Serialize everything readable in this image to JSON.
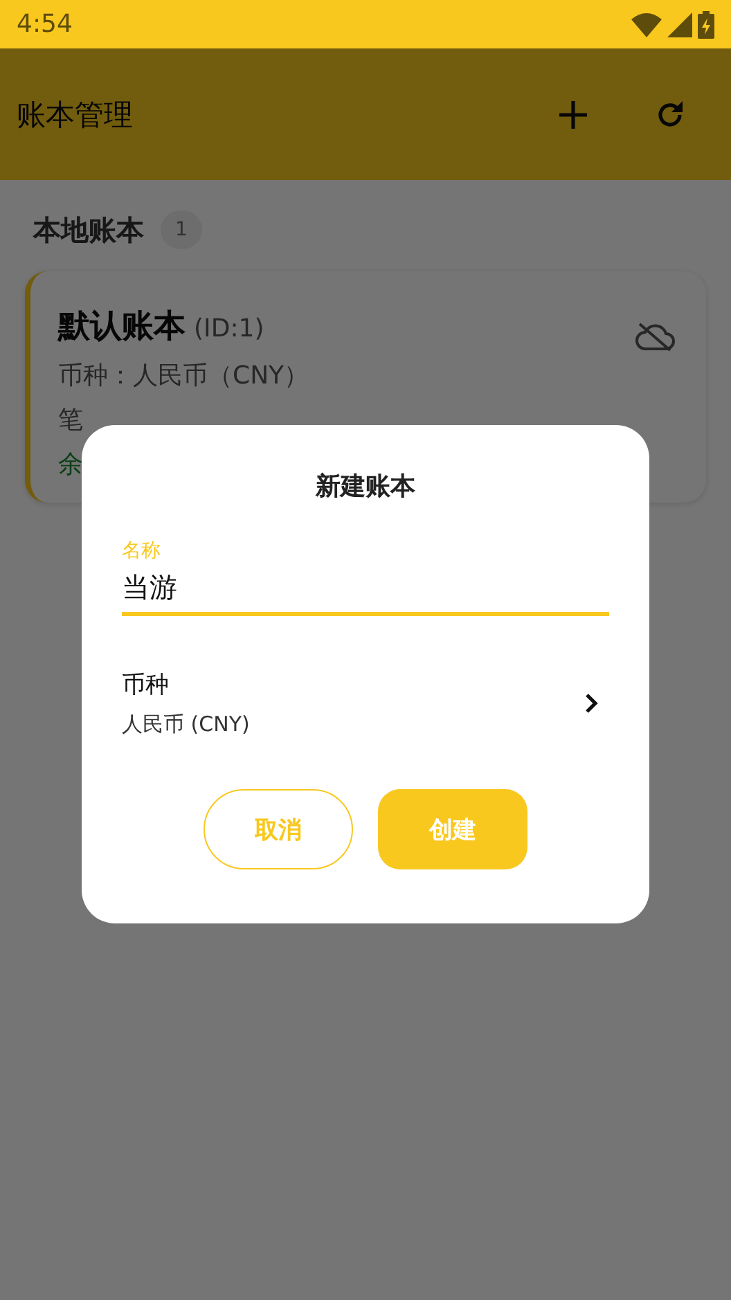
{
  "status_bar": {
    "time": "4:54"
  },
  "app_bar": {
    "title": "账本管理",
    "actions": [
      {
        "kind": "add"
      },
      {
        "kind": "refresh"
      }
    ]
  },
  "section": {
    "title": "本地账本",
    "count": "1"
  },
  "books": [
    {
      "name": "默认账本",
      "id_label": "(ID:1)",
      "synced": false,
      "lines": [
        {
          "kind": "plain",
          "text": "币种：人民币（CNY）"
        },
        {
          "kind": "plain",
          "text": "笔"
        },
        {
          "kind": "balance",
          "text": "余"
        }
      ]
    }
  ],
  "dialog": {
    "title": "新建账本",
    "name_field": {
      "label": "名称",
      "value": "当游",
      "focused": true
    },
    "currency": {
      "label": "币种",
      "value": "人民币 (CNY)"
    },
    "buttons": [
      {
        "label": "取消",
        "kind": "outlined"
      },
      {
        "label": "创建",
        "kind": "filled"
      }
    ]
  }
}
